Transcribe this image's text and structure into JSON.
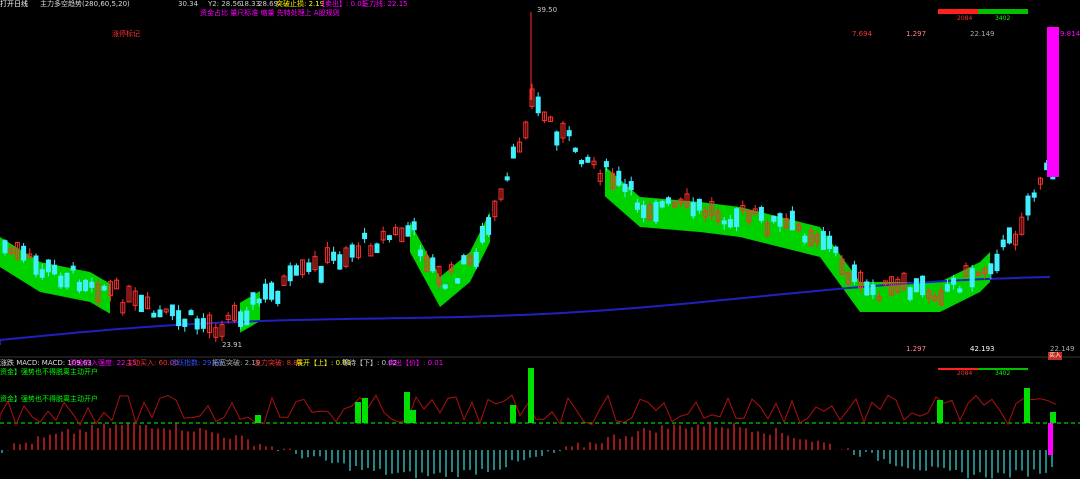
{
  "header": {
    "title": "打开日线",
    "indicator": "主力多空趋势(280,60,5,20)",
    "readouts": [
      {
        "text": "30.34",
        "color": "#cccccc"
      },
      {
        "text": "Y2: 28.56",
        "color": "#cccccc"
      },
      {
        "text": "18.33",
        "color": "#cccccc"
      },
      {
        "text": "28.69",
        "color": "#cccccc"
      },
      {
        "text": "突破止损: 2.19",
        "color": "#ffff00"
      },
      {
        "text": "【卖出】: 0.01",
        "color": "#ff00ff"
      },
      {
        "text": "压力线: 22.15",
        "color": "#ff00ff"
      }
    ],
    "subline": "资金占比  量尺标准  缩量  先特处理上  A股规则"
  },
  "main_panel": {
    "left_marker": "涨停标记",
    "price_top": "7.694",
    "price_mid": "1.297",
    "price_right": "22.149",
    "high_label": "39.50",
    "low_label": "23.91",
    "magenta_label": "9.814",
    "red_count": "2084",
    "green_count": "3402"
  },
  "bottom_bar": {
    "left_value": "1.297",
    "mid_value": "42.193",
    "right_value": "22.149",
    "badge": "买入"
  },
  "macd_panel": {
    "label_main": "涨跌 MACD: MACD: 109.63",
    "items": [
      {
        "text": "资金流入强度: 22.15",
        "color": "#ff00ff"
      },
      {
        "text": "主动买入: 60.00",
        "color": "#ff3030"
      },
      {
        "text": "活跃指数: 29.99",
        "color": "#3050ff"
      },
      {
        "text": "拓宽突破: 2.19",
        "color": "#aaaaaa"
      },
      {
        "text": "主力突破: 8.81",
        "color": "#ff3030"
      },
      {
        "text": "展开【上】: 0.01",
        "color": "#ffff00"
      },
      {
        "text": "等待【下】: 0.02",
        "color": "#cccccc"
      },
      {
        "text": "卖出【价】: 0.01",
        "color": "#ff00ff"
      }
    ],
    "note1": "资金】强势也不得脱离主动开户",
    "note2": "资金】强势也不得脱离主动开户",
    "red_count": "2084",
    "green_count": "3402"
  },
  "colors": {
    "up": "#ff3030",
    "down": "#40f0ff",
    "band": "#00dd00",
    "ma_long": "#2020c0",
    "magenta": "#ff00ff"
  }
}
